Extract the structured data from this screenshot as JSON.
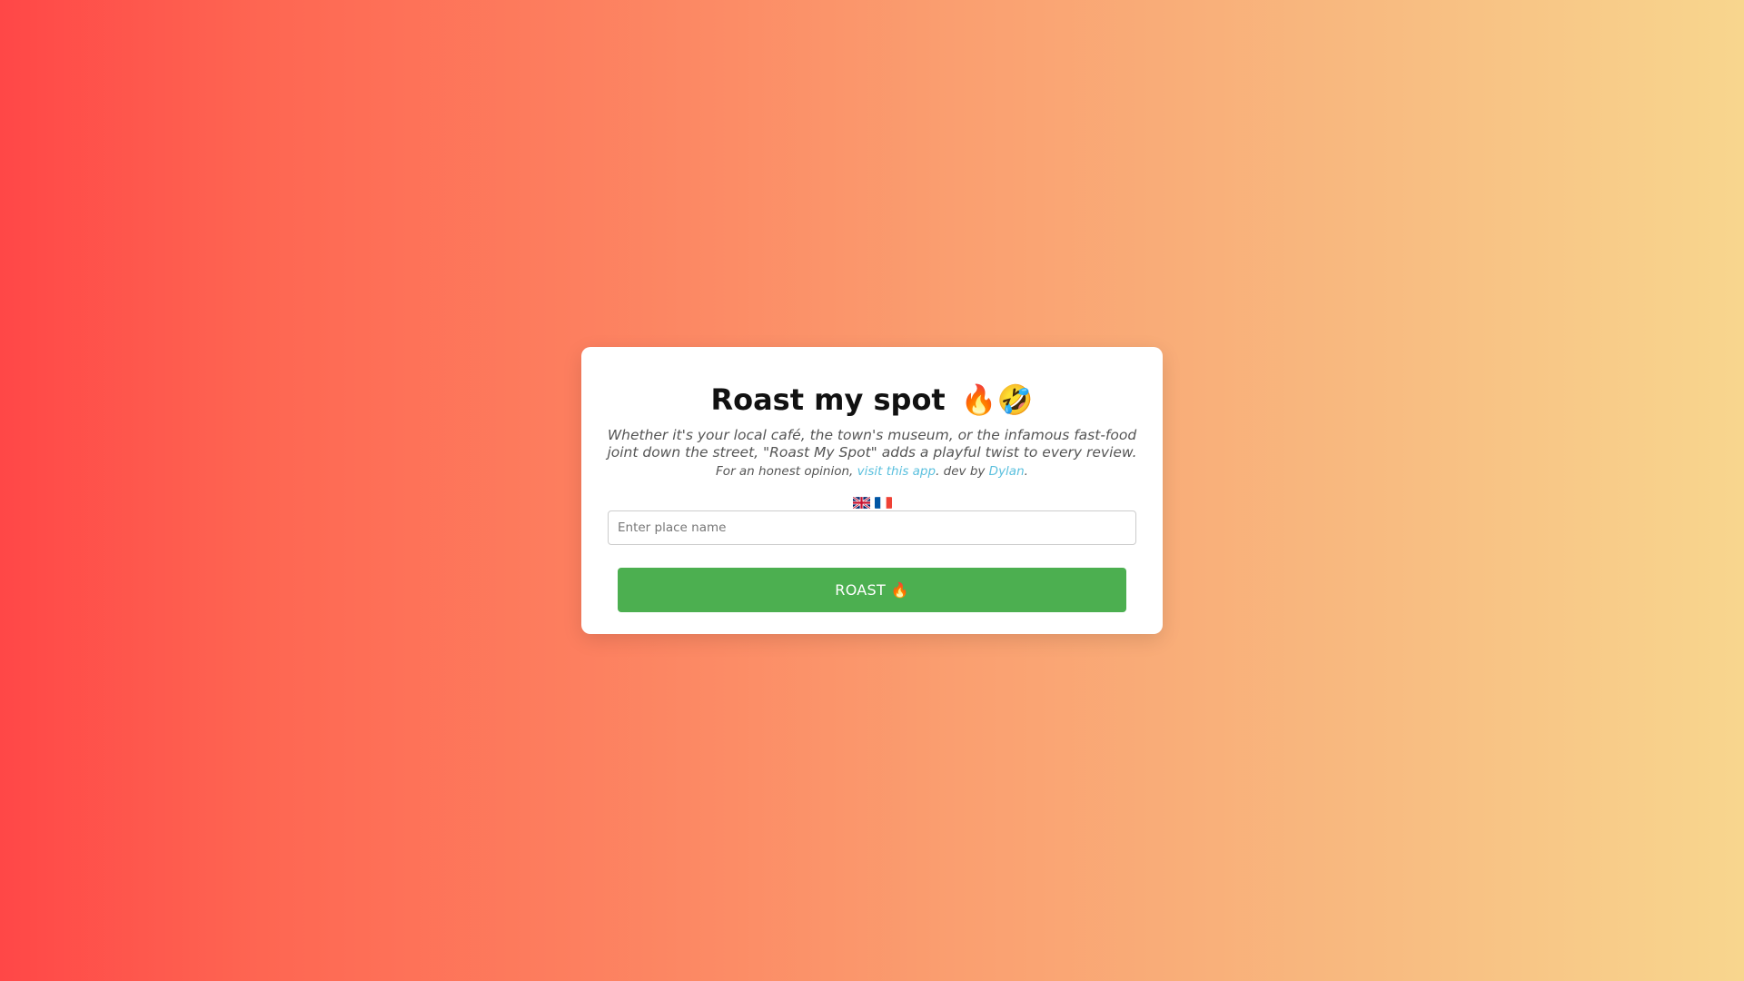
{
  "card": {
    "title": "Roast my spot",
    "title_emoji": "🔥🤣",
    "description": "Whether it's your local café, the town's museum, or the infamous fast-food joint down the street, \"Roast My Spot\" adds a playful twist to every review.",
    "credit": {
      "prefix": "For an honest opinion, ",
      "app_link": "visit this app",
      "middle": ". dev by ",
      "dev_link": "Dylan",
      "suffix": "."
    },
    "languages": [
      {
        "code": "en",
        "icon": "uk-flag-icon"
      },
      {
        "code": "fr",
        "icon": "france-flag-icon"
      }
    ],
    "input": {
      "placeholder": "Enter place name",
      "value": ""
    },
    "button": {
      "label": "ROAST 🔥"
    }
  },
  "colors": {
    "gradient_start": "#ff4747",
    "gradient_end": "#f8d68e",
    "button": "#4caf50",
    "link": "#5bc0de"
  }
}
